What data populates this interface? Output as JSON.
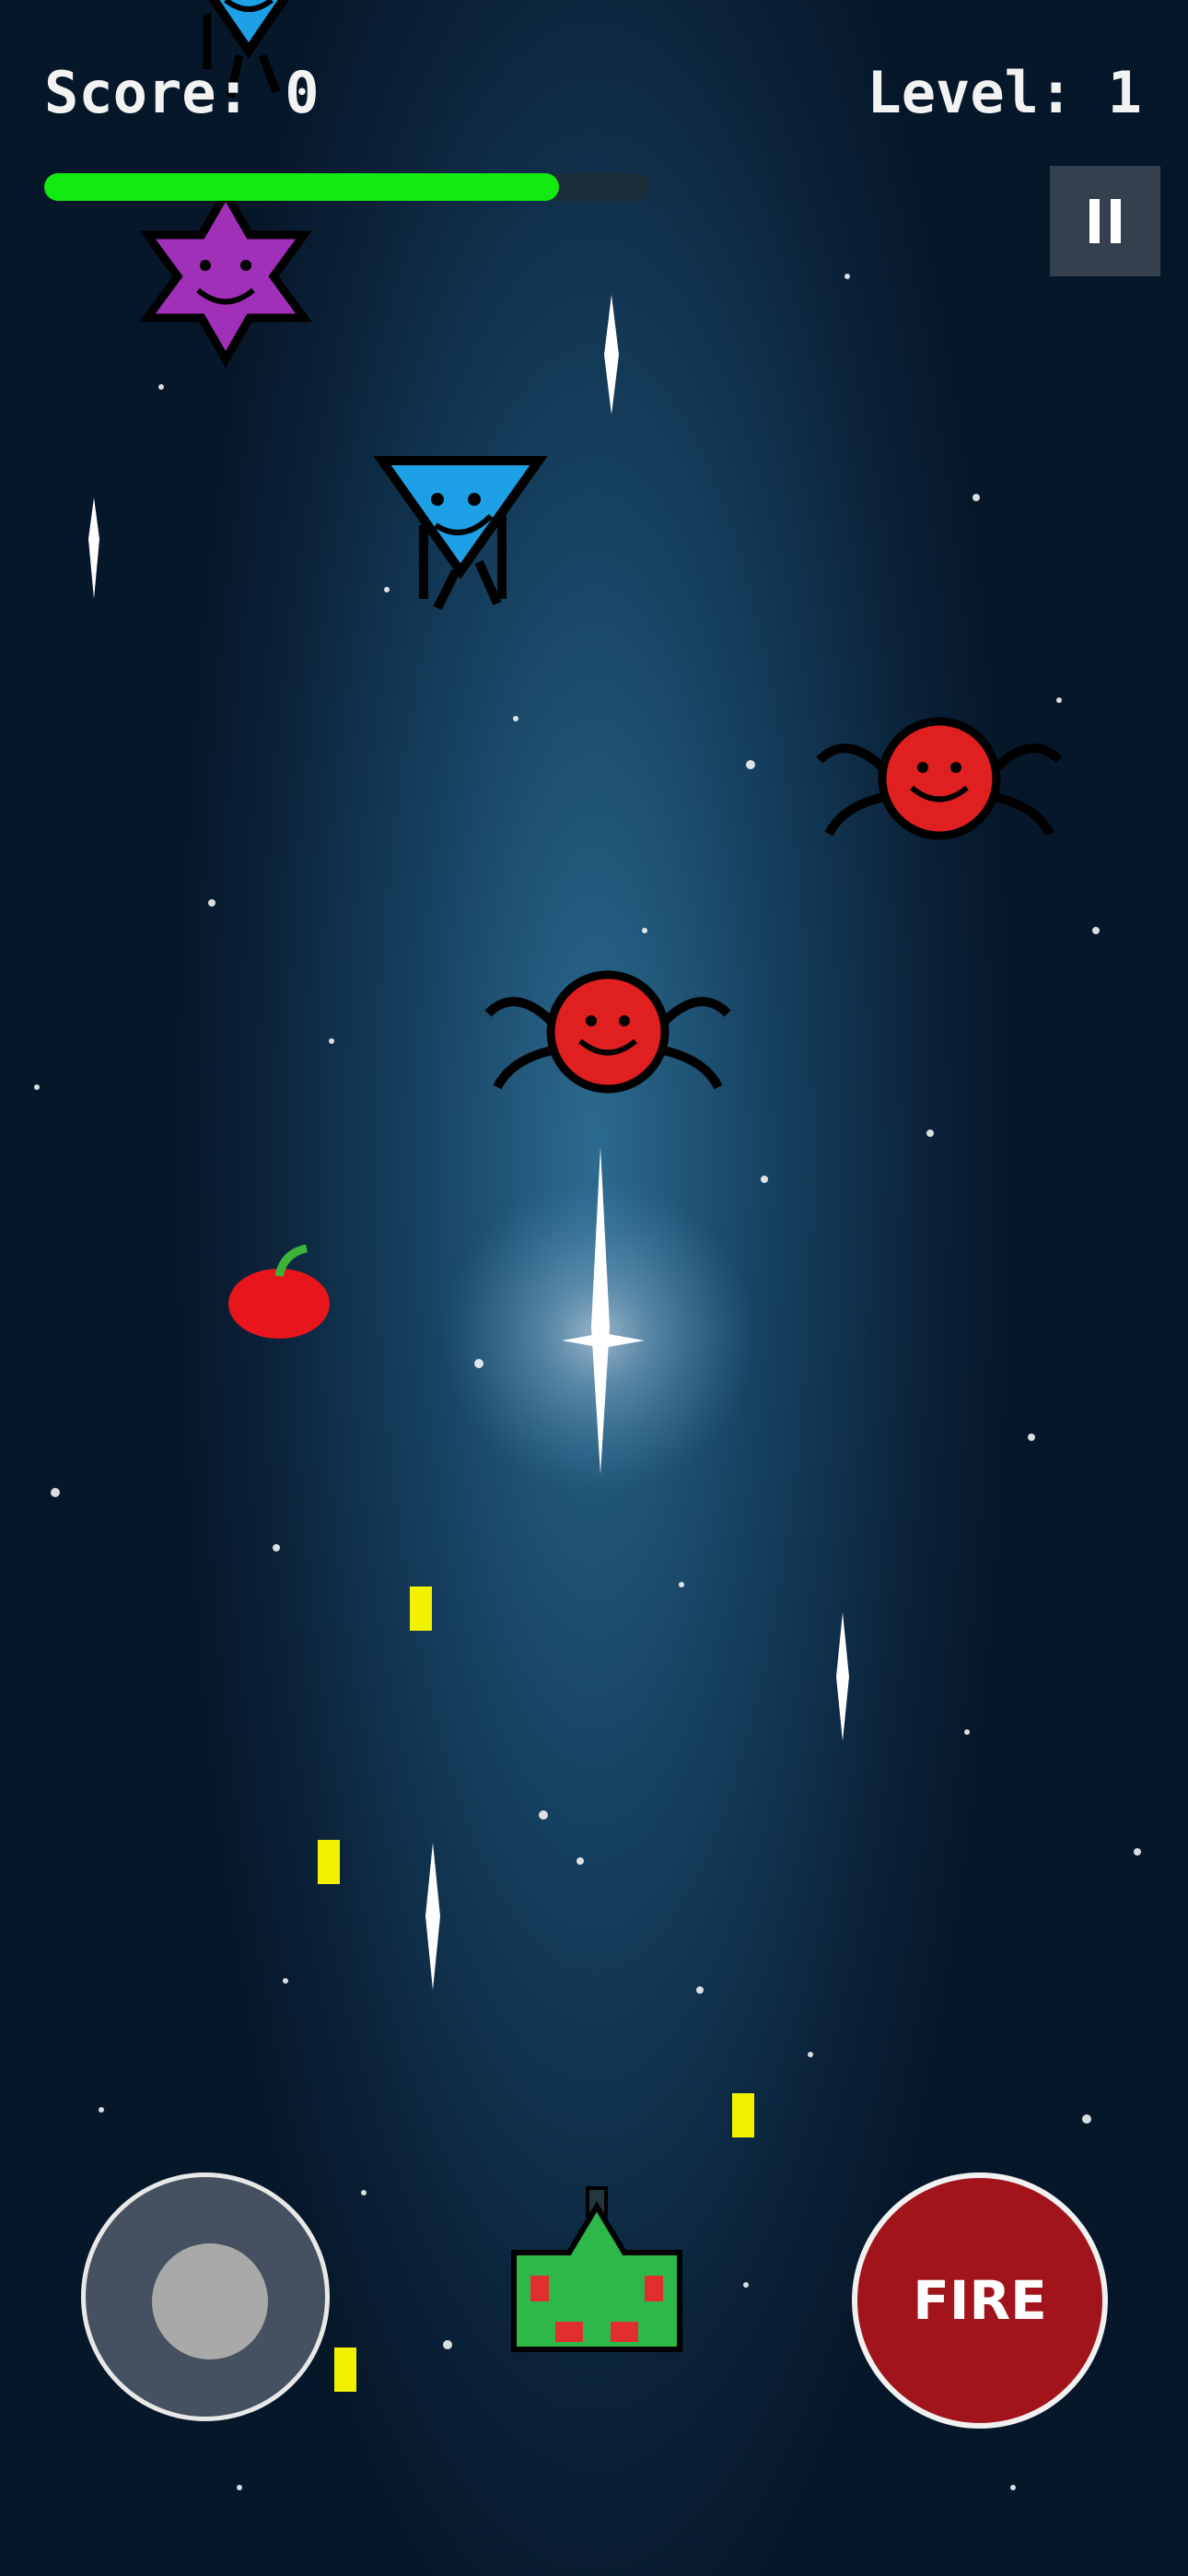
{
  "hud": {
    "score_label": "Score: 0",
    "level_label": "Level: 1",
    "health_fraction": 0.85,
    "pause_icon": "pause-icon"
  },
  "controls": {
    "fire_label": "FIRE",
    "joystick_icon": "joystick"
  },
  "colors": {
    "health_fill": "#12ea12",
    "fire_button": "#a1141b",
    "bullet": "#f2f200",
    "enemy_triangle": "#1ea0e6",
    "enemy_star": "#a030b8",
    "enemy_spider": "#e02020",
    "player_ship": "#2fb84a"
  },
  "entities": {
    "enemy_triangle": "blue-triangle-enemy",
    "enemy_star": "purple-star-enemy",
    "enemy_spider": "red-spider-enemy",
    "powerup": "red-cherry-powerup",
    "player": "green-spaceship"
  }
}
